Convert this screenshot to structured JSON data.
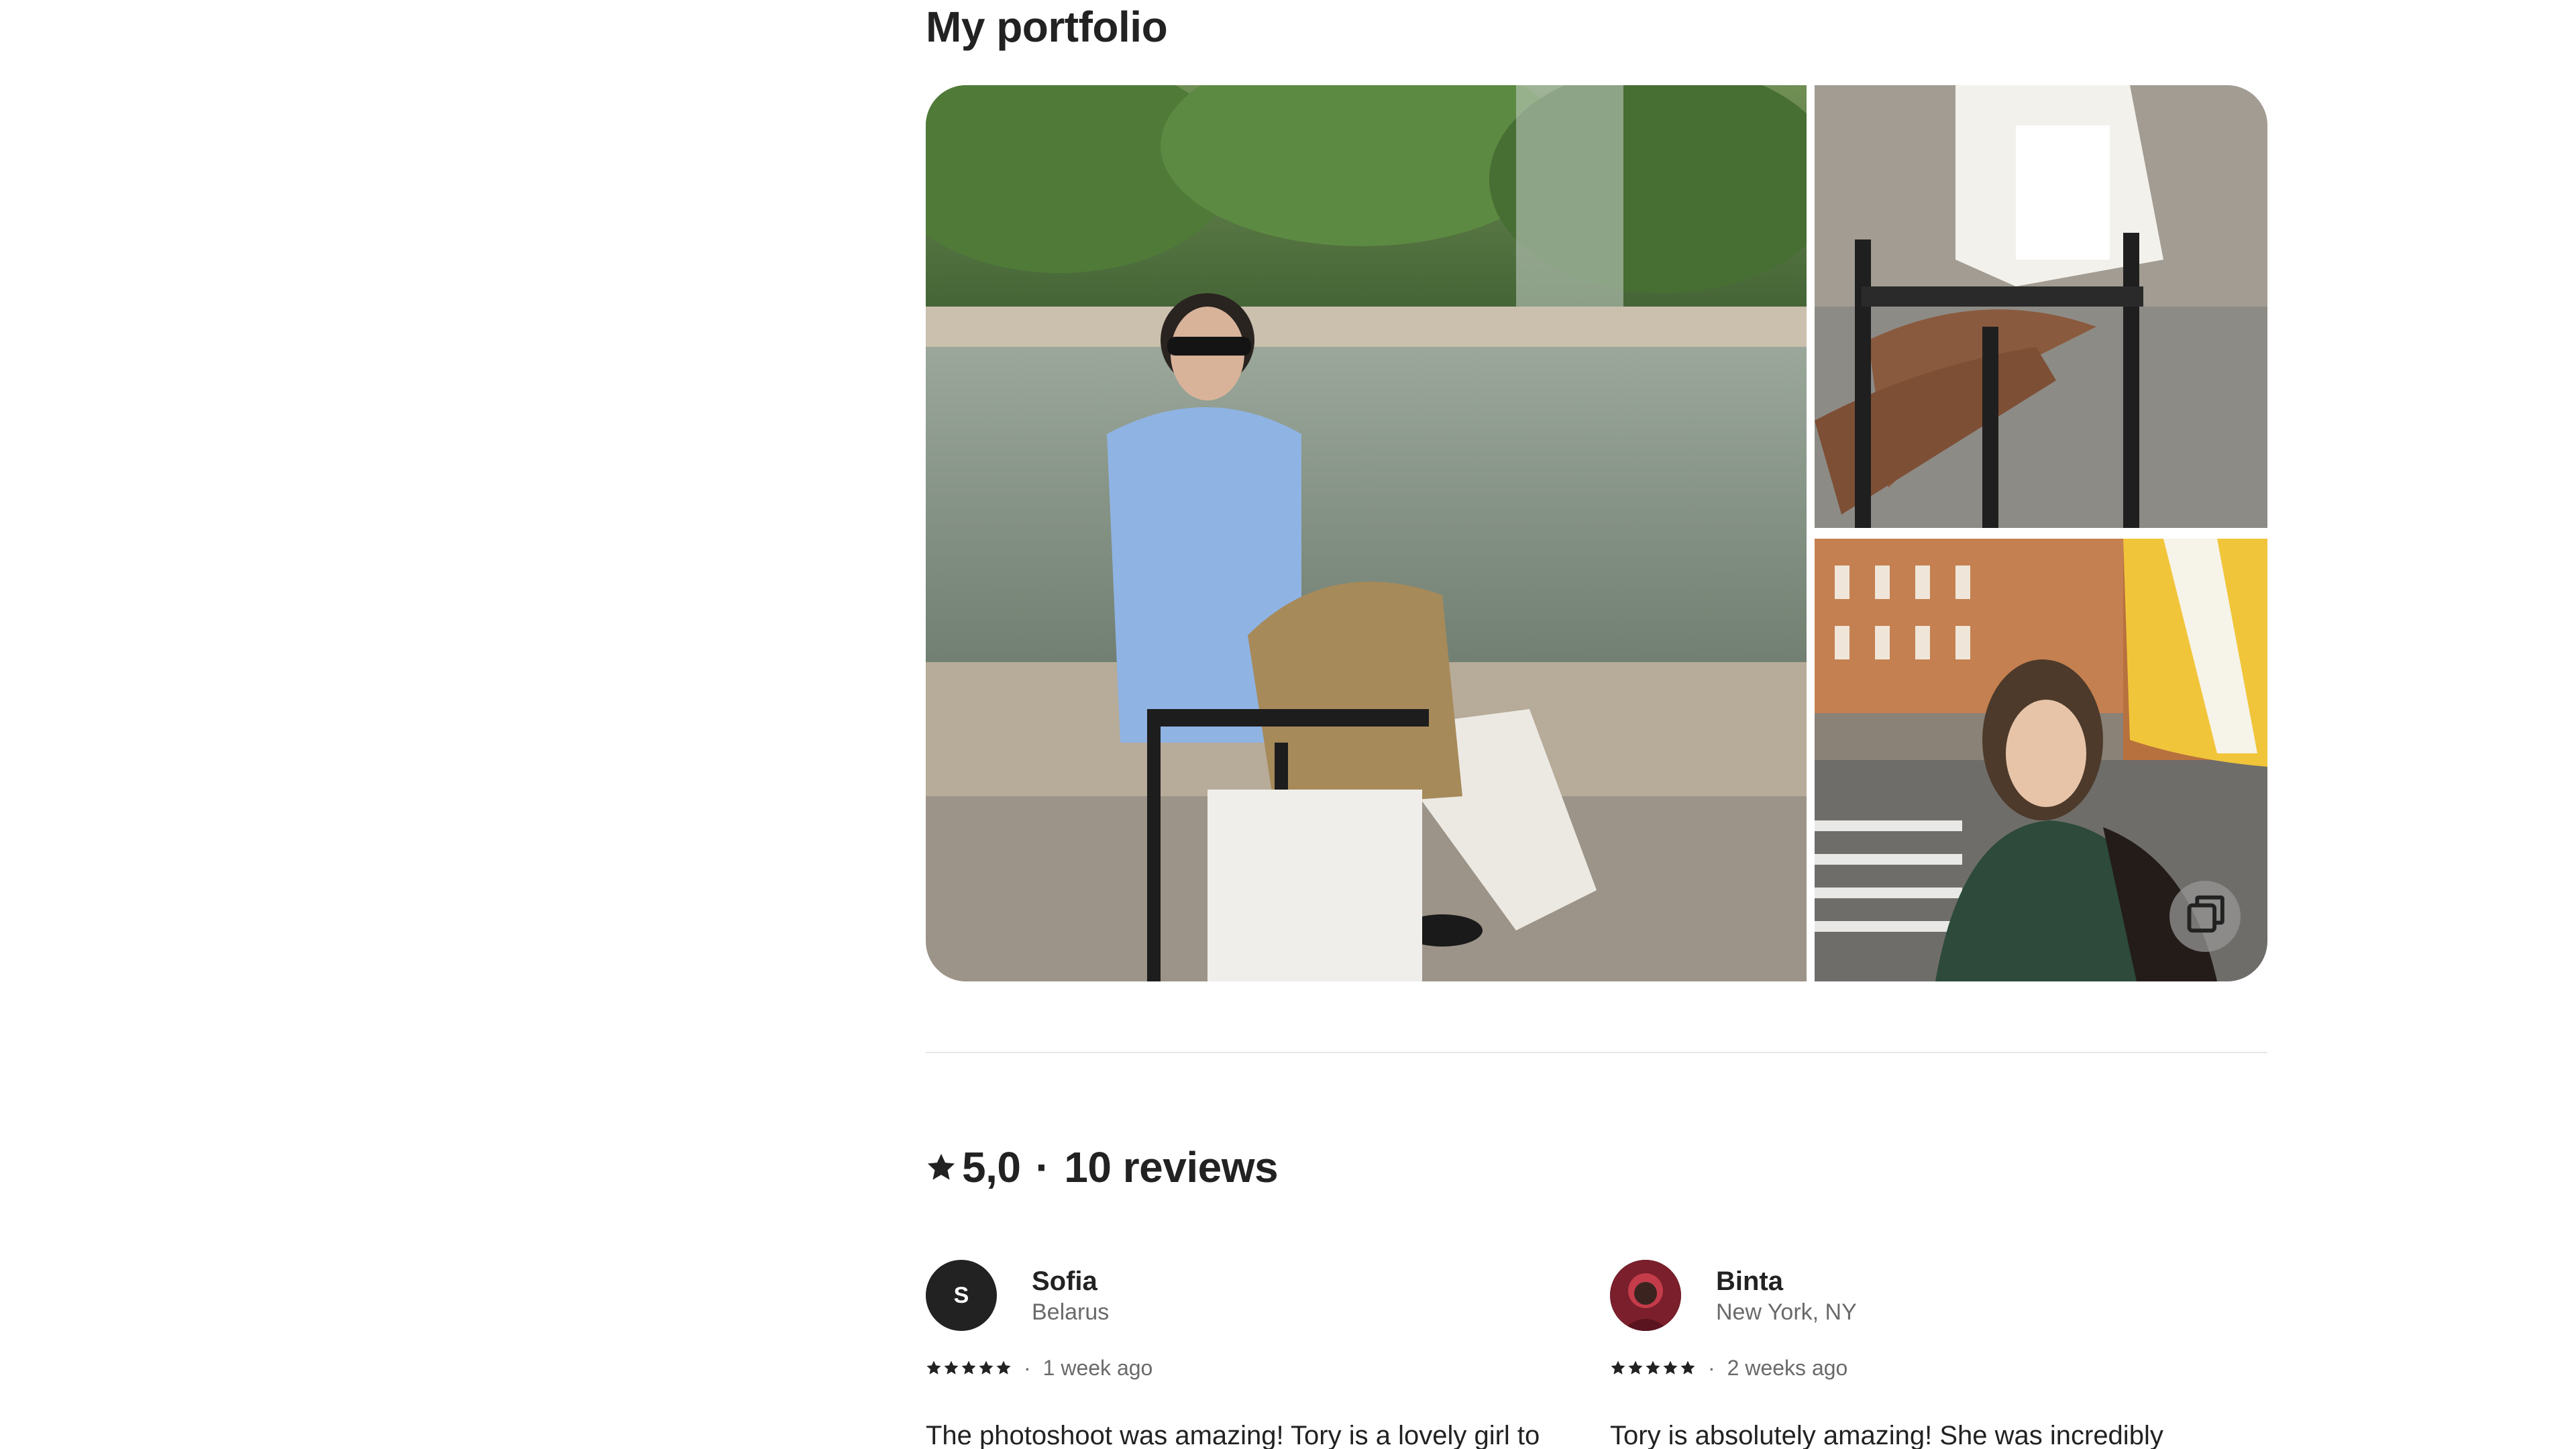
{
  "portfolio": {
    "title": "My portfolio"
  },
  "rating": {
    "score": "5,0",
    "separator": "·",
    "count_label": "10 reviews"
  },
  "reviews": [
    {
      "avatar_initial": "S",
      "name": "Sofia",
      "location": "Belarus",
      "stars": 5,
      "separator": "·",
      "time": "1 week ago",
      "text": "The photoshoot was amazing! Tory is a lovely girl to"
    },
    {
      "avatar_initial": "",
      "name": "Binta",
      "location": "New York, NY",
      "stars": 5,
      "separator": "·",
      "time": "2 weeks ago",
      "text": "Tory is absolutely amazing! She was incredibly helpful"
    }
  ],
  "icons": {
    "star": "star-icon",
    "gallery": "copy-icon"
  },
  "colors": {
    "text": "#222222",
    "muted": "#6a6a6a",
    "divider": "#e6e6e6"
  }
}
